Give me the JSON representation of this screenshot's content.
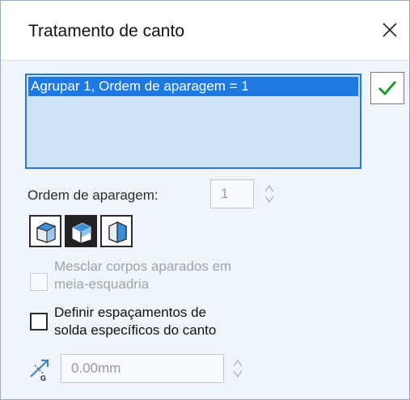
{
  "window": {
    "title": "Tratamento de canto",
    "close_icon": "close-icon"
  },
  "corner_list": {
    "items": [
      {
        "label": "Agrupar 1, Ordem de aparagem = 1",
        "selected": true
      }
    ]
  },
  "ok_button": {
    "icon": "checkmark-icon",
    "accent": "#1a9e2b"
  },
  "trim_order": {
    "label": "Ordem de aparagem:",
    "value": "1",
    "enabled": false
  },
  "trim_type_buttons": [
    {
      "icon": "corner-trim-type-1-icon",
      "selected": false
    },
    {
      "icon": "corner-trim-type-2-icon",
      "selected": true
    },
    {
      "icon": "corner-trim-type-3-icon",
      "selected": false
    }
  ],
  "options": {
    "merge_mitered_bodies": {
      "line1": "Mesclar corpos aparados em",
      "line2": "meia-esquadria",
      "checked": false,
      "enabled": false
    },
    "define_weld_gaps": {
      "line1": "Definir espaçamentos de",
      "line2": "solda específicos do canto",
      "checked": false,
      "enabled": true
    }
  },
  "weld_gap": {
    "icon": "weld-gap-icon",
    "value": "0.00mm",
    "enabled": false
  },
  "colors": {
    "selection": "#1e79e2",
    "list_background": "#cfe3f7",
    "panel_background": "#f0f5fb"
  }
}
